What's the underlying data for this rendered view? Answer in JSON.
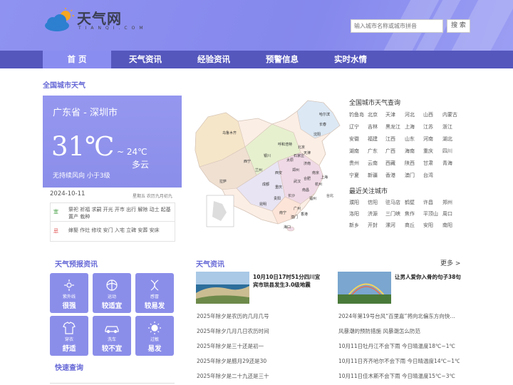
{
  "header": {
    "logo_text": "天气网",
    "logo_sub": "TIANQI.COM",
    "search_placeholder": "输入城市名称或城市拼音",
    "search_button": "搜 索"
  },
  "nav": [
    "首 页",
    "天气资讯",
    "经验资讯",
    "预警信息",
    "实时水情"
  ],
  "section_city_weather": "全国城市天气",
  "weather": {
    "location": "广东省 - 深圳市",
    "temp": "31℃",
    "low": "~ 24℃",
    "condition": "多云",
    "wind": "无持续风向  小于3级",
    "date": "2024-10-11",
    "lunar": "星期五  农历九月初九"
  },
  "almanac": {
    "yi_label": "宜",
    "yi": "祭祀 祈福 求嗣 开光 开市 出行 解除 动土 起基 置产 栽种",
    "ji_label": "忌",
    "ji": "嫁娶 作灶 修坟 安门 入宅 立碑 安葬 安床"
  },
  "map_labels": [
    "乌鲁木齐",
    "拉萨",
    "西宁",
    "兰州",
    "呼和浩特",
    "银川",
    "太原",
    "北京",
    "天津",
    "石家庄",
    "济南",
    "郑州",
    "西安",
    "成都",
    "重庆",
    "长沙",
    "武汉",
    "合肥",
    "南京",
    "上海",
    "杭州",
    "南昌",
    "福州",
    "台北",
    "昆明",
    "贵阳",
    "南宁",
    "广州",
    "澳门",
    "香港",
    "海口",
    "沈阳",
    "长春",
    "哈尔滨"
  ],
  "national_query": {
    "title": "全国城市天气查询",
    "cities": [
      "钓鱼岛",
      "北京",
      "天津",
      "河北",
      "山西",
      "内蒙古",
      "辽宁",
      "吉林",
      "黑龙江",
      "上海",
      "江苏",
      "浙江",
      "安徽",
      "福建",
      "江西",
      "山东",
      "河南",
      "湖北",
      "湖南",
      "广东",
      "广西",
      "海南",
      "重庆",
      "四川",
      "贵州",
      "云南",
      "西藏",
      "陕西",
      "甘肃",
      "青海",
      "宁夏",
      "新疆",
      "香港",
      "澳门",
      "台湾"
    ]
  },
  "recent_focus": {
    "title": "最近关注城市",
    "cities": [
      "濮阳",
      "信阳",
      "驻马店",
      "鹤壁",
      "许昌",
      "郑州",
      "洛阳",
      "济源",
      "三门峡",
      "焦作",
      "平顶山",
      "周口",
      "新乡",
      "开封",
      "漯河",
      "商丘",
      "安阳",
      "南阳"
    ]
  },
  "forecast_section": {
    "title": "天气预报资讯",
    "items": [
      {
        "icon": "uv-icon",
        "small": "紫外线",
        "big": "很强"
      },
      {
        "icon": "sport-icon",
        "small": "运动",
        "big": "较适宜"
      },
      {
        "icon": "allergy-icon",
        "small": "感冒",
        "big": "较易发"
      },
      {
        "icon": "clothing-icon",
        "small": "穿衣",
        "big": "舒适"
      },
      {
        "icon": "carwash-icon",
        "small": "洗车",
        "big": "较不宜"
      },
      {
        "icon": "sun-icon",
        "small": "过敏",
        "big": "易发"
      }
    ],
    "quick_query": "快速查询"
  },
  "news": {
    "title": "天气资讯",
    "more": "更多 >",
    "headline1": "10月10日17时51分四川宜宾市珙县发生3.0级地震",
    "headline2": "让男人爱你入骨的句子38句",
    "left": [
      "2025年除夕是农历的几月几号",
      "2025年除夕几月几日农历时间",
      "2025年除夕是三十还是初一",
      "2025年除夕是腊月29还是30",
      "2025年除夕是二十九还是三十"
    ],
    "right": [
      "2024年第19号台风“百里嘉”将向北偏东方向快…",
      "风暴潮的预防措施 风暴潮怎么防范",
      "10月11日牡丹江不会下雨 今日晴温度18℃~1℃",
      "10月11日齐齐哈尔不会下雨 今日晴温度14℃~1℃",
      "10月11日佳木斯不会下雨 今日晴温度15℃~3℃"
    ]
  },
  "colors": {
    "accent": "#8b8ee9",
    "nav": "#5557bd",
    "header": "#8f92f0"
  }
}
